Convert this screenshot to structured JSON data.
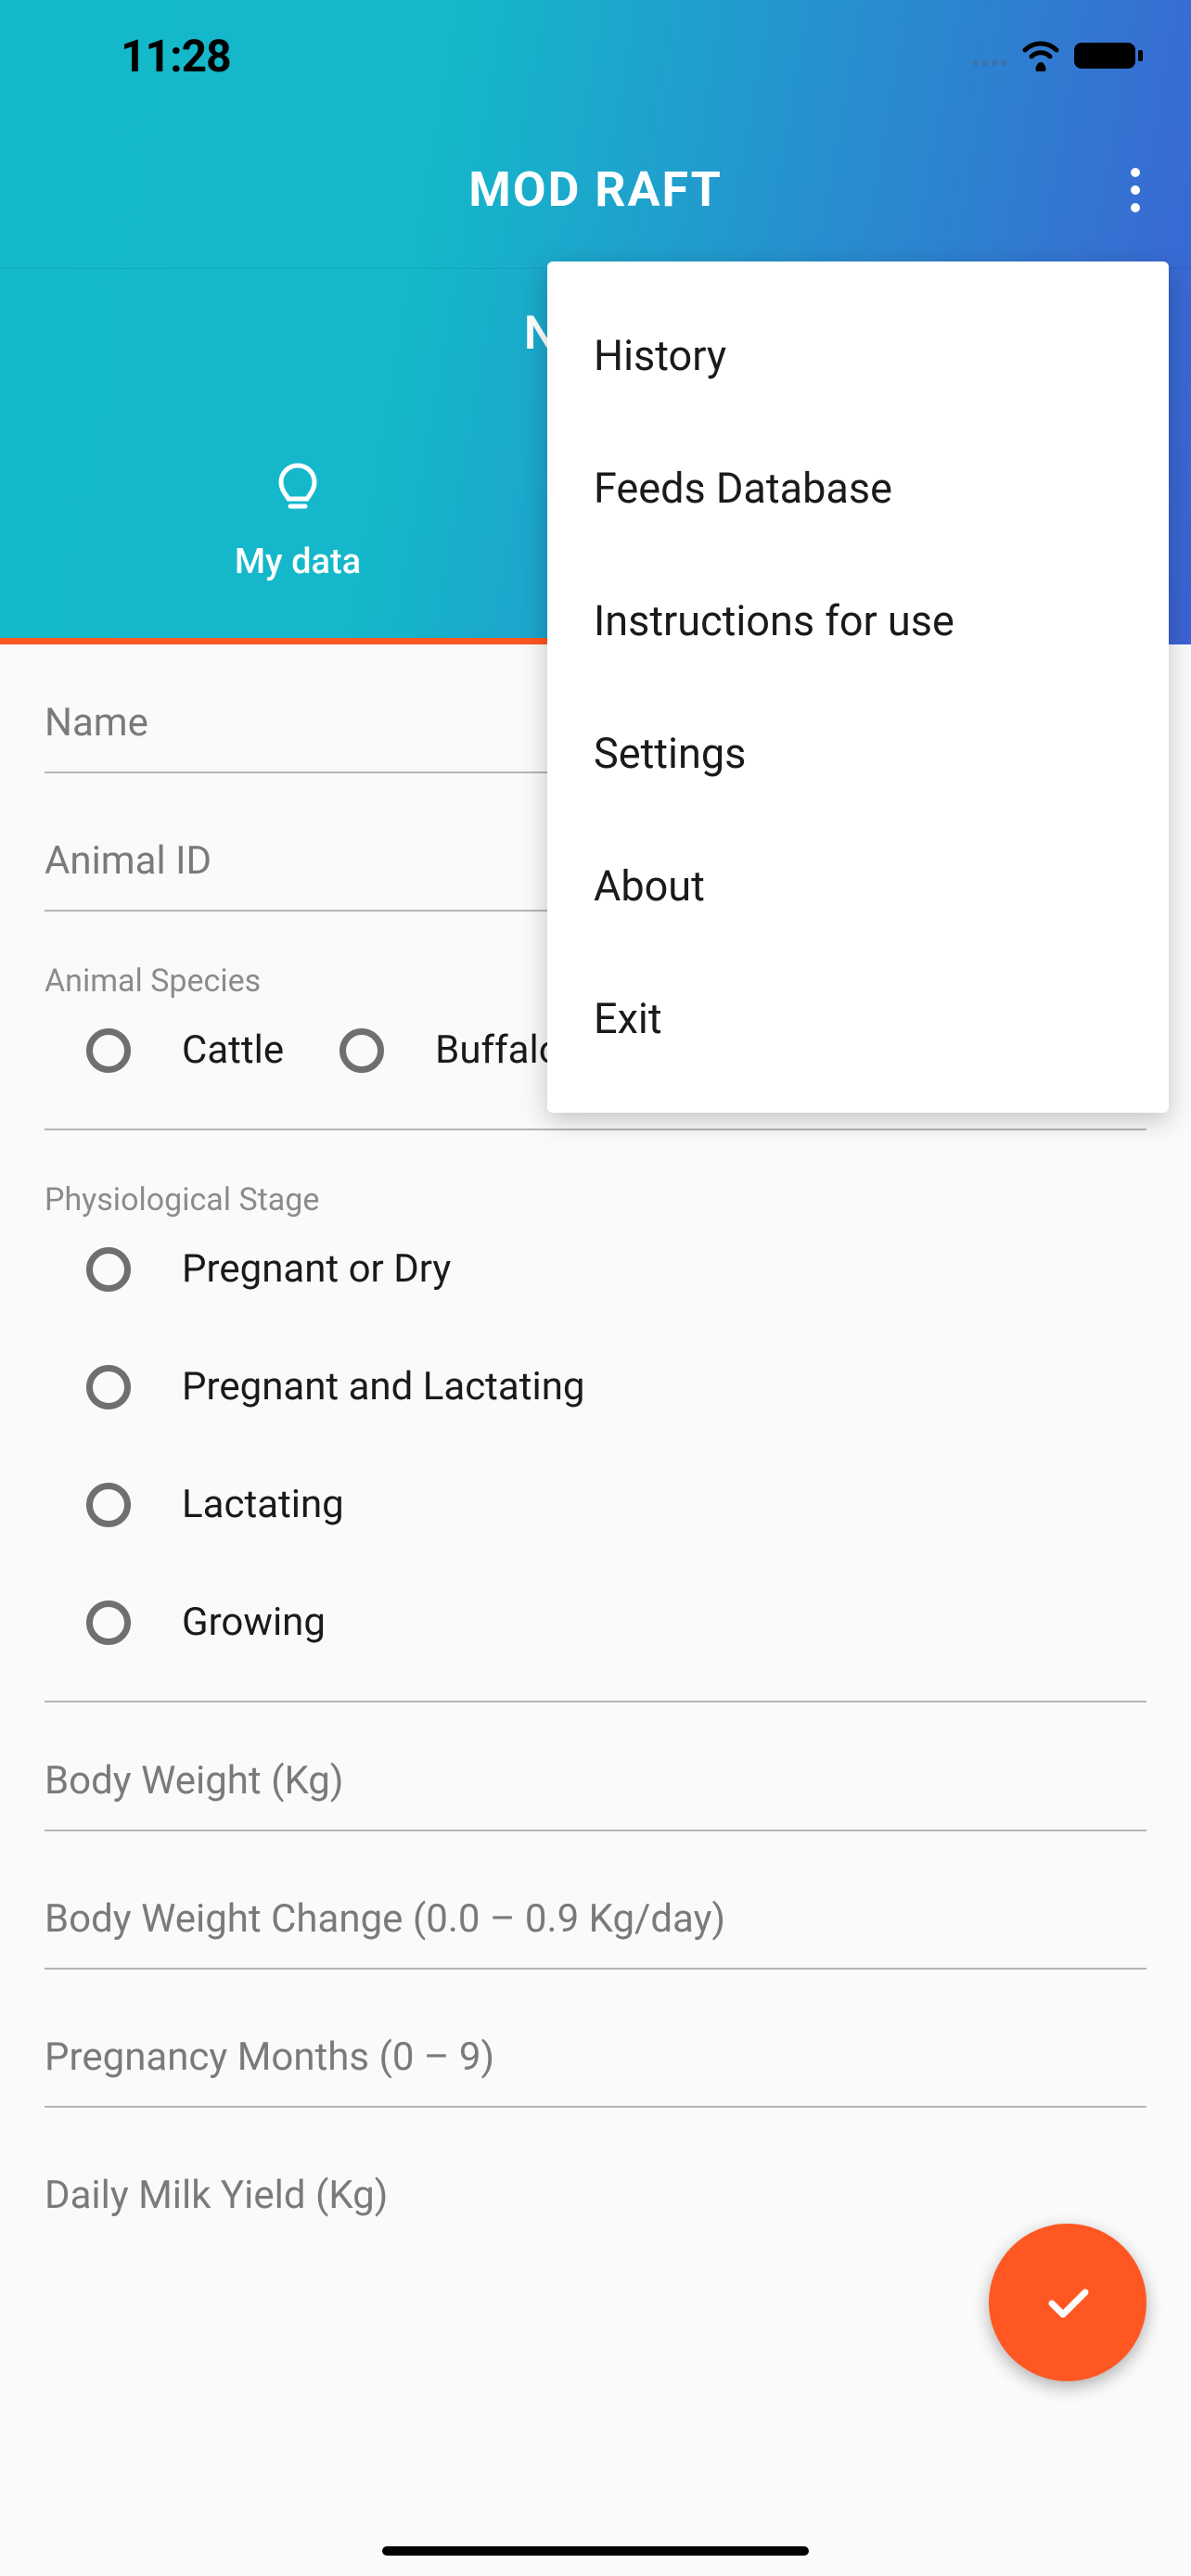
{
  "status": {
    "time": "11:28"
  },
  "header": {
    "app_title": "MOD RAFT",
    "page_subtitle": "New ..."
  },
  "tabs": {
    "active_index": 0,
    "items": [
      {
        "label": "My data"
      },
      {
        "label": ""
      }
    ]
  },
  "form": {
    "name_placeholder": "Name",
    "animal_id_placeholder": "Animal ID",
    "species_label": "Animal Species",
    "species_options": [
      "Cattle",
      "Buffalo"
    ],
    "stage_label": "Physiological Stage",
    "stage_options": [
      "Pregnant or Dry",
      "Pregnant and Lactating",
      "Lactating",
      "Growing"
    ],
    "body_weight_placeholder": "Body Weight (Kg)",
    "body_weight_change_placeholder": "Body Weight Change (0.0 – 0.9 Kg/day)",
    "pregnancy_months_placeholder": "Pregnancy Months (0 – 9)",
    "daily_milk_yield_placeholder": "Daily Milk Yield (Kg)"
  },
  "menu": {
    "items": [
      "History",
      "Feeds Database",
      "Instructions for use",
      "Settings",
      "About",
      "Exit"
    ]
  }
}
